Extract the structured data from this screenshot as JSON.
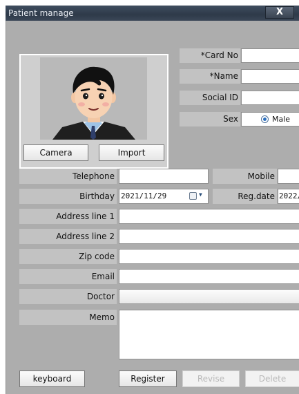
{
  "window": {
    "title": "Patient manage",
    "close_label": "X"
  },
  "photo": {
    "camera_label": "Camera",
    "import_label": "Import"
  },
  "fields": {
    "card_no": {
      "label": "*Card No",
      "value": ""
    },
    "name": {
      "label": "*Name",
      "value": ""
    },
    "social_id": {
      "label": "Social ID",
      "value": ""
    },
    "sex": {
      "label": "Sex",
      "selected": "Male"
    },
    "telephone": {
      "label": "Telephone",
      "value": ""
    },
    "mobile": {
      "label": "Mobile",
      "value": ""
    },
    "birthday": {
      "label": "Birthday",
      "value": "2021/11/29"
    },
    "reg_date": {
      "label": "Reg.date",
      "value": "2022/"
    },
    "address1": {
      "label": "Address line 1",
      "value": ""
    },
    "address2": {
      "label": "Address line 2",
      "value": ""
    },
    "zip": {
      "label": "Zip code",
      "value": ""
    },
    "email": {
      "label": "Email",
      "value": ""
    },
    "doctor": {
      "label": "Doctor",
      "value": ""
    },
    "memo": {
      "label": "Memo",
      "value": ""
    }
  },
  "buttons": {
    "keyboard": "keyboard",
    "register": "Register",
    "revise": "Revise",
    "delete": "Delete"
  }
}
